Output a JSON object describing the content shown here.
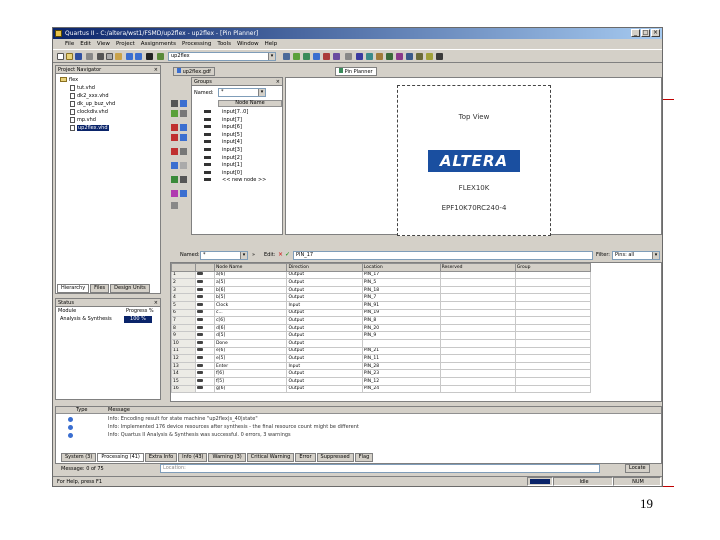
{
  "window": {
    "title": "Quartus II - C:/altera/wst1/FSMD/up2flex - up2flex - [Pin Planner]",
    "controls": [
      "_",
      "□",
      "×"
    ]
  },
  "menu": [
    "File",
    "Edit",
    "View",
    "Project",
    "Assignments",
    "Processing",
    "Tools",
    "Window",
    "Help"
  ],
  "toolbar": {
    "project_combo": "up2flex"
  },
  "navigator": {
    "title": "Project Navigator",
    "root": "flex",
    "files": [
      "tut.vhd",
      "dk2_xxx.vhd",
      "dk_up_buz_vhd",
      "clockdiv.vhd",
      "mp.vhd",
      "up2flex.vhd"
    ],
    "tabs": [
      "Hierarchy",
      "Files",
      "Design Units"
    ]
  },
  "status_panel": {
    "title": "Status",
    "columns": [
      "Module",
      "Progress %"
    ],
    "row": {
      "module": "Analysis & Synthesis",
      "progress": "100 %"
    }
  },
  "editor_tabs": [
    "up2flex.gdf",
    "Pin Planner"
  ],
  "groups": {
    "title": "Groups",
    "named_label": "Named:",
    "named_value": "*",
    "node_header": "Node Name",
    "nodes": [
      "input[7..0]",
      "input[7]",
      "input[6]",
      "input[5]",
      "input[4]",
      "input[3]",
      "input[2]",
      "input[1]",
      "input[0]",
      "<< new node >>"
    ]
  },
  "chip": {
    "view_label": "Top View",
    "brand": "ALTERA",
    "family": "FLEX10K",
    "device": "EPF10K70RC240-4"
  },
  "filter_bar": {
    "named_label": "Named:",
    "named_value": "*",
    "edit_label": "Edit:",
    "edit_value": "PIN_17",
    "filter_label": "Filter:",
    "filter_value": "Pins: all"
  },
  "pin_table": {
    "columns": [
      "",
      "",
      "Node Name",
      "Direction",
      "Location",
      "Reserved",
      "Group"
    ],
    "rows": [
      {
        "n": "1",
        "name": "a[6]",
        "dir": "Output",
        "loc": "PIN_17"
      },
      {
        "n": "2",
        "name": "a[5]",
        "dir": "Output",
        "loc": "PIN_5"
      },
      {
        "n": "3",
        "name": "b[6]",
        "dir": "Output",
        "loc": "PIN_18"
      },
      {
        "n": "4",
        "name": "b[5]",
        "dir": "Output",
        "loc": "PIN_7"
      },
      {
        "n": "5",
        "name": "Clock",
        "dir": "Input",
        "loc": "PIN_91"
      },
      {
        "n": "6",
        "name": "c...",
        "dir": "Output",
        "loc": "PIN_19"
      },
      {
        "n": "7",
        "name": "c[6]",
        "dir": "Output",
        "loc": "PIN_8"
      },
      {
        "n": "8",
        "name": "d[6]",
        "dir": "Output",
        "loc": "PIN_20"
      },
      {
        "n": "9",
        "name": "d[5]",
        "dir": "Output",
        "loc": "PIN_9"
      },
      {
        "n": "10",
        "name": "Done",
        "dir": "Output",
        "loc": ""
      },
      {
        "n": "11",
        "name": "e[6]",
        "dir": "Output",
        "loc": "PIN_21"
      },
      {
        "n": "12",
        "name": "e[5]",
        "dir": "Output",
        "loc": "PIN_11"
      },
      {
        "n": "13",
        "name": "Enter",
        "dir": "Input",
        "loc": "PIN_28"
      },
      {
        "n": "14",
        "name": "f[6]",
        "dir": "Output",
        "loc": "PIN_23"
      },
      {
        "n": "15",
        "name": "f[5]",
        "dir": "Output",
        "loc": "PIN_12"
      },
      {
        "n": "16",
        "name": "g[6]",
        "dir": "Output",
        "loc": "PIN_24"
      }
    ]
  },
  "messages": {
    "columns": [
      "Type",
      "Message"
    ],
    "lines": [
      "Info: Encoding result for state machine \"up2flex|s_40|state\"",
      "Info: Implemented 176 device resources after synthesis - the final resource count might be different",
      "Info: Quartus II Analysis & Synthesis was successful. 0 errors, 3 warnings"
    ],
    "tabs": [
      "System (3)",
      "Processing (41)",
      "Extra Info",
      "Info (43)",
      "Warning (3)",
      "Critical Warning",
      "Error",
      "Suppressed",
      "Flag"
    ],
    "message_label": "Message: 0 of 75",
    "location_placeholder": "Location:",
    "locate_button": "Locate"
  },
  "status_bar": {
    "help": "For Help, press F1",
    "state": "Idle",
    "mode": "NUM"
  },
  "slide_number": "19"
}
